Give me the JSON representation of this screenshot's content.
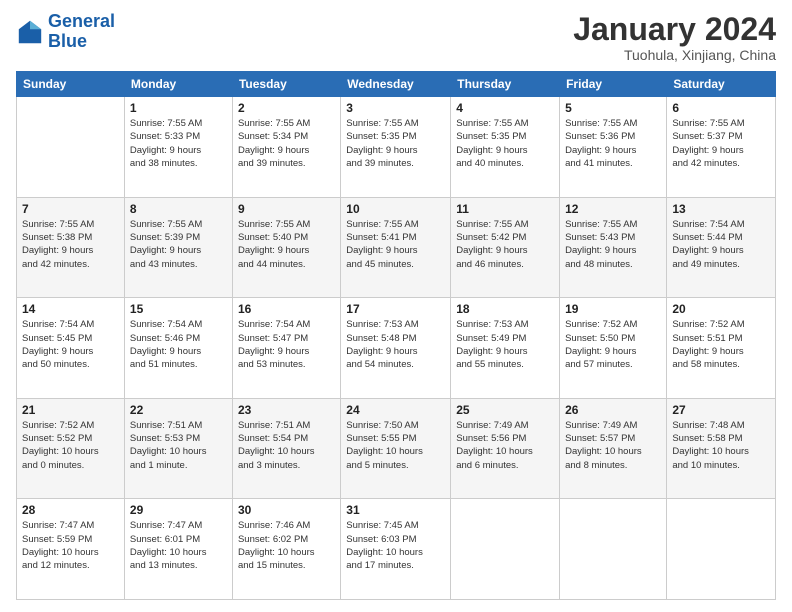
{
  "logo": {
    "line1": "General",
    "line2": "Blue"
  },
  "header": {
    "title": "January 2024",
    "location": "Tuohula, Xinjiang, China"
  },
  "days_of_week": [
    "Sunday",
    "Monday",
    "Tuesday",
    "Wednesday",
    "Thursday",
    "Friday",
    "Saturday"
  ],
  "weeks": [
    [
      {
        "day": "",
        "info": ""
      },
      {
        "day": "1",
        "info": "Sunrise: 7:55 AM\nSunset: 5:33 PM\nDaylight: 9 hours\nand 38 minutes."
      },
      {
        "day": "2",
        "info": "Sunrise: 7:55 AM\nSunset: 5:34 PM\nDaylight: 9 hours\nand 39 minutes."
      },
      {
        "day": "3",
        "info": "Sunrise: 7:55 AM\nSunset: 5:35 PM\nDaylight: 9 hours\nand 39 minutes."
      },
      {
        "day": "4",
        "info": "Sunrise: 7:55 AM\nSunset: 5:35 PM\nDaylight: 9 hours\nand 40 minutes."
      },
      {
        "day": "5",
        "info": "Sunrise: 7:55 AM\nSunset: 5:36 PM\nDaylight: 9 hours\nand 41 minutes."
      },
      {
        "day": "6",
        "info": "Sunrise: 7:55 AM\nSunset: 5:37 PM\nDaylight: 9 hours\nand 42 minutes."
      }
    ],
    [
      {
        "day": "7",
        "info": "Sunrise: 7:55 AM\nSunset: 5:38 PM\nDaylight: 9 hours\nand 42 minutes."
      },
      {
        "day": "8",
        "info": "Sunrise: 7:55 AM\nSunset: 5:39 PM\nDaylight: 9 hours\nand 43 minutes."
      },
      {
        "day": "9",
        "info": "Sunrise: 7:55 AM\nSunset: 5:40 PM\nDaylight: 9 hours\nand 44 minutes."
      },
      {
        "day": "10",
        "info": "Sunrise: 7:55 AM\nSunset: 5:41 PM\nDaylight: 9 hours\nand 45 minutes."
      },
      {
        "day": "11",
        "info": "Sunrise: 7:55 AM\nSunset: 5:42 PM\nDaylight: 9 hours\nand 46 minutes."
      },
      {
        "day": "12",
        "info": "Sunrise: 7:55 AM\nSunset: 5:43 PM\nDaylight: 9 hours\nand 48 minutes."
      },
      {
        "day": "13",
        "info": "Sunrise: 7:54 AM\nSunset: 5:44 PM\nDaylight: 9 hours\nand 49 minutes."
      }
    ],
    [
      {
        "day": "14",
        "info": "Sunrise: 7:54 AM\nSunset: 5:45 PM\nDaylight: 9 hours\nand 50 minutes."
      },
      {
        "day": "15",
        "info": "Sunrise: 7:54 AM\nSunset: 5:46 PM\nDaylight: 9 hours\nand 51 minutes."
      },
      {
        "day": "16",
        "info": "Sunrise: 7:54 AM\nSunset: 5:47 PM\nDaylight: 9 hours\nand 53 minutes."
      },
      {
        "day": "17",
        "info": "Sunrise: 7:53 AM\nSunset: 5:48 PM\nDaylight: 9 hours\nand 54 minutes."
      },
      {
        "day": "18",
        "info": "Sunrise: 7:53 AM\nSunset: 5:49 PM\nDaylight: 9 hours\nand 55 minutes."
      },
      {
        "day": "19",
        "info": "Sunrise: 7:52 AM\nSunset: 5:50 PM\nDaylight: 9 hours\nand 57 minutes."
      },
      {
        "day": "20",
        "info": "Sunrise: 7:52 AM\nSunset: 5:51 PM\nDaylight: 9 hours\nand 58 minutes."
      }
    ],
    [
      {
        "day": "21",
        "info": "Sunrise: 7:52 AM\nSunset: 5:52 PM\nDaylight: 10 hours\nand 0 minutes."
      },
      {
        "day": "22",
        "info": "Sunrise: 7:51 AM\nSunset: 5:53 PM\nDaylight: 10 hours\nand 1 minute."
      },
      {
        "day": "23",
        "info": "Sunrise: 7:51 AM\nSunset: 5:54 PM\nDaylight: 10 hours\nand 3 minutes."
      },
      {
        "day": "24",
        "info": "Sunrise: 7:50 AM\nSunset: 5:55 PM\nDaylight: 10 hours\nand 5 minutes."
      },
      {
        "day": "25",
        "info": "Sunrise: 7:49 AM\nSunset: 5:56 PM\nDaylight: 10 hours\nand 6 minutes."
      },
      {
        "day": "26",
        "info": "Sunrise: 7:49 AM\nSunset: 5:57 PM\nDaylight: 10 hours\nand 8 minutes."
      },
      {
        "day": "27",
        "info": "Sunrise: 7:48 AM\nSunset: 5:58 PM\nDaylight: 10 hours\nand 10 minutes."
      }
    ],
    [
      {
        "day": "28",
        "info": "Sunrise: 7:47 AM\nSunset: 5:59 PM\nDaylight: 10 hours\nand 12 minutes."
      },
      {
        "day": "29",
        "info": "Sunrise: 7:47 AM\nSunset: 6:01 PM\nDaylight: 10 hours\nand 13 minutes."
      },
      {
        "day": "30",
        "info": "Sunrise: 7:46 AM\nSunset: 6:02 PM\nDaylight: 10 hours\nand 15 minutes."
      },
      {
        "day": "31",
        "info": "Sunrise: 7:45 AM\nSunset: 6:03 PM\nDaylight: 10 hours\nand 17 minutes."
      },
      {
        "day": "",
        "info": ""
      },
      {
        "day": "",
        "info": ""
      },
      {
        "day": "",
        "info": ""
      }
    ]
  ]
}
